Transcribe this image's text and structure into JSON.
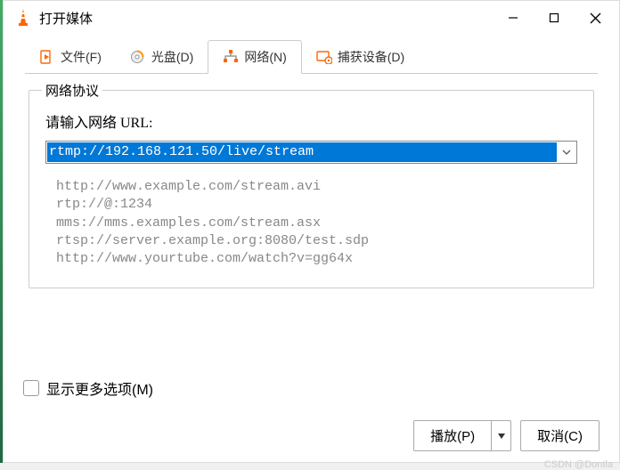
{
  "window": {
    "title": "打开媒体"
  },
  "tabs": {
    "file": "文件(F)",
    "disc": "光盘(D)",
    "network": "网络(N)",
    "capture": "捕获设备(D)"
  },
  "network": {
    "legend": "网络协议",
    "prompt": "请输入网络 URL:",
    "url": "rtmp://192.168.121.50/live/stream",
    "examples": [
      "http://www.example.com/stream.avi",
      "rtp://@:1234",
      "mms://mms.examples.com/stream.asx",
      "rtsp://server.example.org:8080/test.sdp",
      "http://www.yourtube.com/watch?v=gg64x"
    ]
  },
  "footer": {
    "more_options": "显示更多选项(M)",
    "play": "播放(P)",
    "cancel": "取消(C)"
  },
  "watermark": "CSDN @Dontla"
}
